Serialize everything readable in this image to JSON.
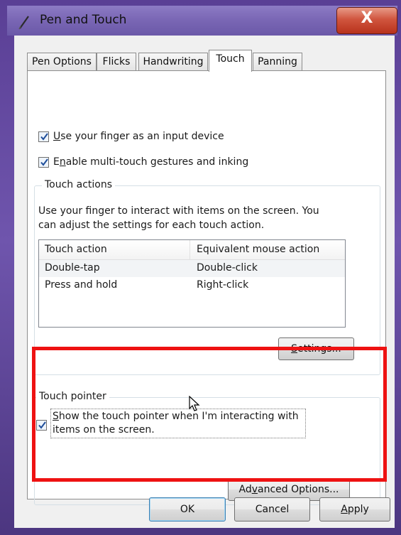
{
  "window": {
    "title": "Pen and Touch",
    "close_glyph": "X",
    "title_icon": "pen-icon"
  },
  "tabs": [
    {
      "label": "Pen Options",
      "active": false
    },
    {
      "label": "Flicks",
      "active": false
    },
    {
      "label": "Handwriting",
      "active": false
    },
    {
      "label": "Touch",
      "active": true
    },
    {
      "label": "Panning",
      "active": false
    }
  ],
  "touch": {
    "use_finger": {
      "pre": "",
      "key": "U",
      "post": "se your finger as an input device",
      "checked": true
    },
    "multitouch": {
      "pre": "E",
      "key": "n",
      "post": "able multi-touch gestures and inking",
      "checked": true
    }
  },
  "touch_actions": {
    "title": "Touch actions",
    "description_line1": "Use your finger to interact with items on the screen. You",
    "description_line2": "can adjust the settings for each touch action.",
    "columns": [
      "Touch action",
      "Equivalent mouse action"
    ],
    "rows": [
      {
        "action": "Double-tap",
        "mouse": "Double-click"
      },
      {
        "action": "Press and hold",
        "mouse": "Right-click"
      }
    ],
    "settings_button": {
      "key": "S",
      "rest": "ettings..."
    }
  },
  "touch_pointer": {
    "title": "Touch pointer",
    "show_pointer": {
      "key": "S",
      "line1_rest": "how the touch pointer when I'm interacting with",
      "line2": "items on the screen.",
      "checked": true
    },
    "advanced_button": {
      "pre": "Ad",
      "key": "v",
      "post": "anced Options..."
    }
  },
  "footer": {
    "ok": "OK",
    "cancel": "Cancel",
    "apply_key": "A",
    "apply_rest": "pply"
  },
  "colors": {
    "highlight": "#ee1212",
    "close_red": "#c83a24",
    "check_blue": "#1f4e9a"
  }
}
